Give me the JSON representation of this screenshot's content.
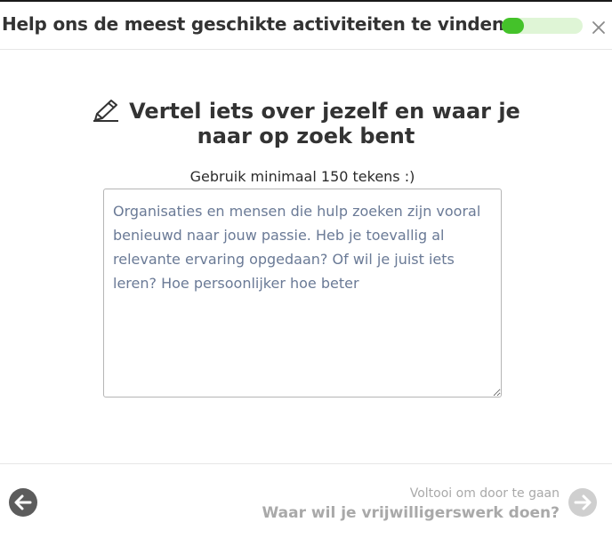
{
  "header": {
    "title": "Help ons de meest geschikte activiteiten te vinden",
    "progress_fraction": 0.28,
    "close_icon": "close-icon"
  },
  "main": {
    "heading_icon": "pencil-edit-icon",
    "heading": "Vertel iets over jezelf en waar je naar op zoek bent",
    "subtitle": "Gebruik minimaal 150 tekens :)",
    "textarea": {
      "value": "",
      "placeholder": "Organisaties en mensen die hulp zoeken zijn vooral benieuwd naar jouw passie. Heb je toevallig al relevante ervaring opgedaan? Of wil je juist iets leren? Hoe persoonlijker hoe beter"
    }
  },
  "footer": {
    "back_icon": "arrow-left-icon",
    "next_hint": "Voltooi om door te gaan",
    "next_label": "Waar wil je vrijwilligerswerk doen?",
    "next_icon": "arrow-right-icon"
  },
  "colors": {
    "progress_fill": "#44c22a",
    "progress_track": "#dff5d6",
    "text_primary": "#333333",
    "placeholder": "#6a7a96",
    "disabled": "#a9a9a9"
  }
}
